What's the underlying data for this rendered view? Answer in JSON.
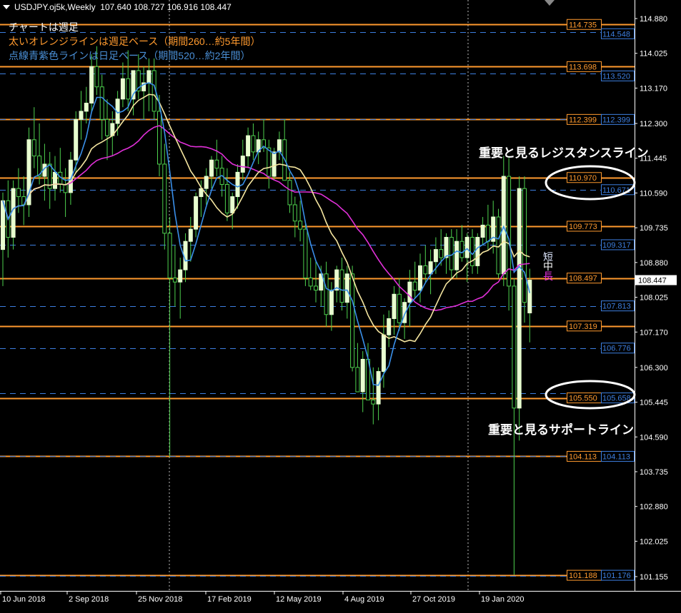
{
  "header": {
    "symbol": "USDJPY.oj5k,Weekly",
    "ohlc": "107.640 108.727 106.916 108.447"
  },
  "notes": [
    "チャートは週足",
    "太いオレンジラインは週足ベース（期間260…約5年間）",
    "点線青紫色ラインは日足ベース（期間520…約2年間）"
  ],
  "labels": {
    "resistance": "重要と見るレジスタンスライン",
    "support": "重要と見るサポートライン",
    "short_ma": "短",
    "mid_ma": "中",
    "long_ma": "長"
  },
  "price_axis": {
    "ticks": [
      "114.880",
      "114.025",
      "113.170",
      "112.300",
      "111.445",
      "110.590",
      "109.735",
      "108.880",
      "108.025",
      "107.170",
      "106.300",
      "105.445",
      "104.590",
      "103.735",
      "102.880",
      "102.025",
      "101.155"
    ],
    "current": "108.447"
  },
  "time_axis": [
    "10 Jun 2018",
    "2 Sep 2018",
    "25 Nov 2018",
    "17 Feb 2019",
    "12 May 2019",
    "4 Aug 2019",
    "27 Oct 2019",
    "19 Jan 2020"
  ],
  "colors": {
    "orange": "#ff9a2e",
    "blue": "#3d7fe0",
    "bull_body": "#e8ffd0",
    "wick": "#4ed14e",
    "ma_short": "#3a8fe8",
    "ma_mid": "#f5e6a0",
    "ma_long": "#e030d8"
  },
  "chart_data": {
    "type": "candlestick",
    "weekly_levels": [
      {
        "label": "114.735",
        "value": 114.735
      },
      {
        "label": "113.698",
        "value": 113.698
      },
      {
        "label": "112.399",
        "value": 112.399
      },
      {
        "label": "110.970",
        "value": 110.97
      },
      {
        "label": "109.773",
        "value": 109.773
      },
      {
        "label": "108.497",
        "value": 108.497
      },
      {
        "label": "107.319",
        "value": 107.319
      },
      {
        "label": "105.550",
        "value": 105.55
      },
      {
        "label": "104.113",
        "value": 104.113
      },
      {
        "label": "101.188",
        "value": 101.188
      }
    ],
    "daily_levels": [
      {
        "label": "114.548",
        "value": 114.548
      },
      {
        "label": "113.520",
        "value": 113.52
      },
      {
        "label": "112.399",
        "value": 112.399
      },
      {
        "label": "110.671",
        "value": 110.671
      },
      {
        "label": "109.317",
        "value": 109.317
      },
      {
        "label": "107.813",
        "value": 107.813
      },
      {
        "label": "106.776",
        "value": 106.776
      },
      {
        "label": "105.658",
        "value": 105.658
      },
      {
        "label": "104.113",
        "value": 104.113
      },
      {
        "label": "101.176",
        "value": 101.176
      }
    ],
    "candles": [
      [
        109.2,
        110.6,
        108.3,
        110.4
      ],
      [
        110.4,
        110.9,
        109.0,
        109.5
      ],
      [
        109.5,
        110.9,
        109.2,
        110.7
      ],
      [
        110.7,
        111.2,
        110.1,
        110.5
      ],
      [
        110.5,
        111.0,
        109.8,
        110.3
      ],
      [
        110.3,
        112.2,
        110.0,
        111.9
      ],
      [
        111.9,
        112.7,
        111.2,
        111.5
      ],
      [
        111.5,
        112.3,
        110.8,
        111.0
      ],
      [
        111.0,
        111.8,
        110.4,
        111.3
      ],
      [
        111.3,
        111.6,
        110.2,
        110.7
      ],
      [
        110.7,
        111.5,
        110.4,
        111.1
      ],
      [
        111.1,
        111.7,
        110.6,
        110.8
      ],
      [
        110.8,
        111.2,
        110.0,
        110.6
      ],
      [
        110.6,
        111.6,
        110.3,
        111.4
      ],
      [
        111.4,
        112.6,
        111.1,
        112.4
      ],
      [
        112.4,
        113.1,
        111.9,
        112.6
      ],
      [
        112.6,
        113.2,
        112.3,
        112.8
      ],
      [
        112.8,
        114.0,
        112.6,
        113.7
      ],
      [
        113.7,
        114.2,
        113.0,
        113.2
      ],
      [
        113.2,
        113.5,
        111.9,
        112.4
      ],
      [
        112.4,
        112.9,
        111.4,
        112.0
      ],
      [
        112.0,
        112.6,
        111.5,
        112.3
      ],
      [
        112.3,
        113.1,
        112.0,
        112.9
      ],
      [
        112.9,
        113.8,
        112.7,
        113.4
      ],
      [
        113.4,
        114.1,
        112.6,
        112.9
      ],
      [
        112.9,
        113.6,
        112.5,
        113.6
      ],
      [
        113.6,
        114.0,
        112.9,
        113.1
      ],
      [
        113.1,
        113.7,
        112.4,
        113.3
      ],
      [
        113.3,
        113.9,
        112.6,
        113.6
      ],
      [
        113.6,
        113.9,
        112.4,
        112.6
      ],
      [
        112.6,
        113.0,
        111.0,
        111.3
      ],
      [
        111.3,
        111.8,
        109.2,
        109.6
      ],
      [
        109.6,
        110.0,
        104.1,
        108.5
      ],
      [
        108.5,
        109.3,
        107.8,
        108.4
      ],
      [
        108.4,
        109.0,
        107.5,
        108.7
      ],
      [
        108.7,
        109.6,
        108.4,
        109.4
      ],
      [
        109.4,
        110.0,
        108.9,
        109.7
      ],
      [
        109.7,
        110.6,
        109.5,
        110.5
      ],
      [
        110.5,
        110.9,
        110.0,
        110.7
      ],
      [
        110.7,
        111.2,
        110.3,
        111.0
      ],
      [
        111.0,
        111.5,
        110.7,
        111.4
      ],
      [
        111.4,
        111.9,
        111.0,
        111.2
      ],
      [
        111.2,
        111.5,
        110.5,
        110.8
      ],
      [
        110.8,
        111.2,
        109.9,
        110.1
      ],
      [
        110.1,
        110.6,
        109.7,
        110.5
      ],
      [
        110.5,
        111.3,
        110.2,
        111.1
      ],
      [
        111.1,
        111.9,
        110.9,
        111.5
      ],
      [
        111.5,
        112.2,
        111.2,
        112.0
      ],
      [
        112.0,
        112.3,
        111.4,
        111.6
      ],
      [
        111.6,
        112.1,
        111.3,
        111.9
      ],
      [
        111.9,
        112.4,
        111.6,
        111.7
      ],
      [
        111.7,
        111.9,
        110.7,
        111.0
      ],
      [
        111.0,
        111.7,
        110.9,
        111.6
      ],
      [
        111.6,
        112.1,
        111.4,
        111.9
      ],
      [
        111.9,
        112.4,
        111.5,
        110.9
      ],
      [
        110.9,
        111.1,
        110.1,
        110.3
      ],
      [
        110.3,
        110.5,
        109.5,
        109.9
      ],
      [
        109.9,
        110.4,
        109.4,
        109.7
      ],
      [
        109.7,
        109.9,
        108.3,
        108.5
      ],
      [
        108.5,
        109.0,
        108.2,
        108.3
      ],
      [
        108.3,
        108.9,
        107.9,
        108.2
      ],
      [
        108.2,
        108.8,
        107.8,
        108.6
      ],
      [
        108.6,
        108.9,
        107.3,
        107.6
      ],
      [
        107.6,
        108.4,
        107.2,
        108.2
      ],
      [
        108.2,
        108.8,
        107.9,
        108.7
      ],
      [
        108.7,
        109.0,
        107.7,
        107.9
      ],
      [
        107.9,
        108.8,
        107.5,
        108.6
      ],
      [
        108.6,
        108.8,
        106.2,
        106.3
      ],
      [
        106.3,
        106.9,
        105.7,
        105.7
      ],
      [
        105.7,
        106.7,
        105.2,
        106.5
      ],
      [
        106.5,
        106.9,
        105.5,
        105.5
      ],
      [
        105.5,
        106.3,
        104.9,
        105.4
      ],
      [
        105.4,
        106.3,
        105.0,
        106.2
      ],
      [
        106.2,
        107.6,
        105.8,
        107.1
      ],
      [
        107.1,
        107.7,
        106.8,
        107.5
      ],
      [
        107.5,
        108.3,
        107.1,
        108.1
      ],
      [
        108.1,
        108.5,
        107.2,
        107.4
      ],
      [
        107.4,
        108.0,
        107.0,
        107.9
      ],
      [
        107.9,
        108.7,
        107.3,
        108.4
      ],
      [
        108.4,
        108.9,
        108.0,
        108.2
      ],
      [
        108.2,
        109.1,
        107.9,
        108.8
      ],
      [
        108.8,
        109.3,
        108.4,
        108.6
      ],
      [
        108.6,
        109.2,
        108.1,
        108.9
      ],
      [
        108.9,
        109.5,
        108.6,
        109.2
      ],
      [
        109.2,
        109.7,
        108.8,
        109.0
      ],
      [
        109.0,
        109.6,
        108.6,
        109.5
      ],
      [
        109.5,
        109.7,
        108.5,
        108.7
      ],
      [
        108.7,
        109.7,
        108.5,
        109.4
      ],
      [
        109.4,
        109.8,
        108.9,
        109.0
      ],
      [
        109.0,
        109.6,
        108.4,
        109.5
      ],
      [
        109.5,
        109.7,
        108.6,
        108.8
      ],
      [
        108.8,
        109.6,
        108.6,
        109.5
      ],
      [
        109.5,
        110.0,
        109.3,
        109.8
      ],
      [
        109.8,
        110.3,
        109.2,
        109.4
      ],
      [
        109.4,
        110.4,
        109.1,
        110.0
      ],
      [
        110.0,
        110.2,
        108.5,
        108.6
      ],
      [
        108.6,
        111.5,
        108.3,
        111.0
      ],
      [
        111.0,
        111.5,
        107.7,
        108.3
      ],
      [
        108.3,
        108.5,
        101.2,
        105.3
      ],
      [
        105.3,
        111.0,
        104.5,
        110.7
      ],
      [
        110.7,
        111.0,
        107.4,
        107.9
      ],
      [
        107.64,
        108.727,
        106.916,
        108.447
      ]
    ]
  }
}
